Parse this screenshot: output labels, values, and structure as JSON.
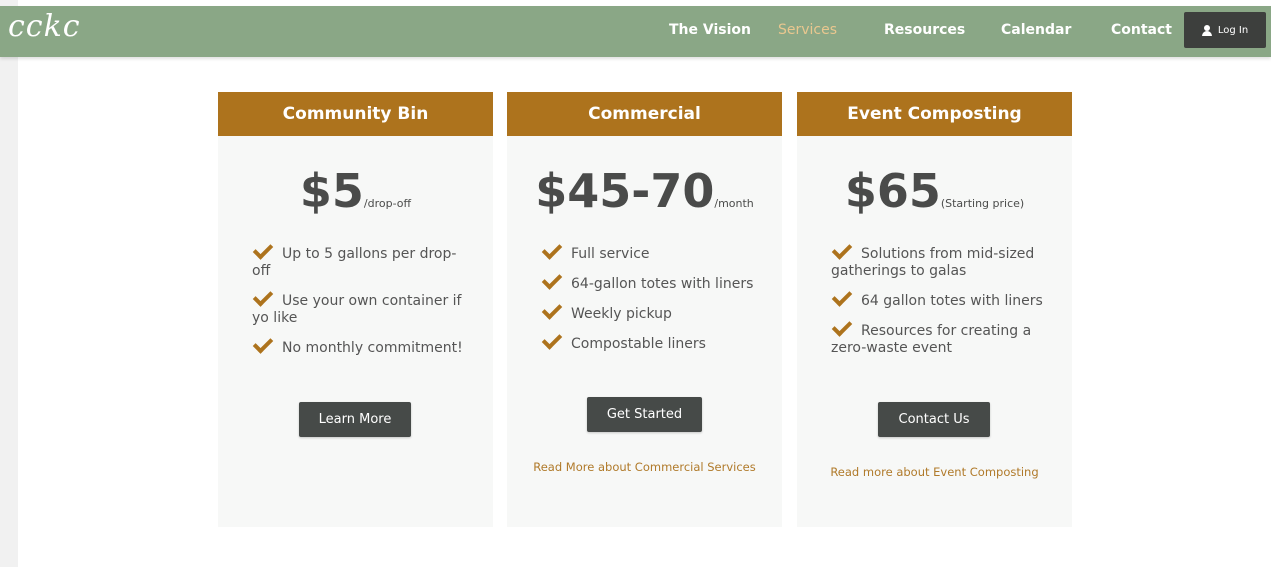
{
  "header": {
    "logo": "cckc",
    "nav": [
      "The Vision",
      "Services",
      "Resources",
      "Calendar",
      "Contact"
    ],
    "active_nav": "Services",
    "login_label": "Log In",
    "colors": {
      "bar": "#8aa786",
      "active": "#e9c78f"
    }
  },
  "cards": [
    {
      "title": "Community Bin",
      "price": "$5",
      "unit": "/drop-off",
      "features": [
        "Up to 5 gallons per drop-off",
        "Use your own container if yo like",
        "No monthly commitment!"
      ],
      "button": "Learn More",
      "link": ""
    },
    {
      "title": "Commercial",
      "price": "$45-70",
      "unit": "/month",
      "features": [
        "Full service",
        "64-gallon totes with liners",
        "Weekly pickup",
        "Compostable liners"
      ],
      "button": "Get Started",
      "link": "Read More about Commercial Services"
    },
    {
      "title": "Event Composting",
      "price": "$65",
      "unit": "(Starting price)",
      "features": [
        "Solutions from mid-sized gatherings to galas",
        "64 gallon totes with liners",
        "Resources for creating a zero-waste event"
      ],
      "button": "Contact Us",
      "link": "Read more about Event Composting"
    }
  ],
  "theme": {
    "accent": "#ad731d",
    "button": "#464a48",
    "card_bg": "#f7f8f7"
  }
}
